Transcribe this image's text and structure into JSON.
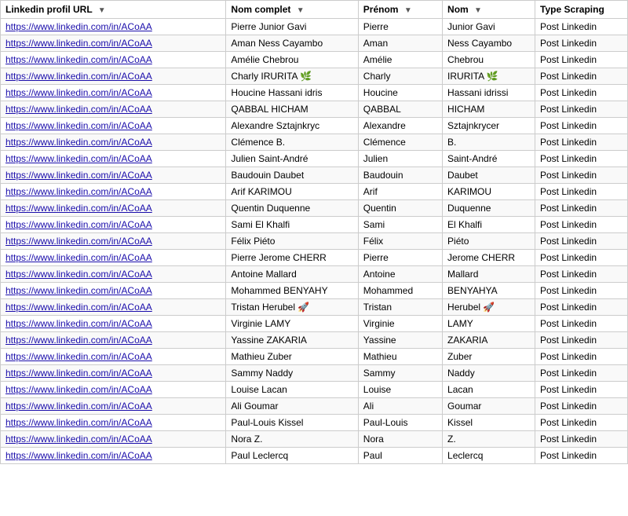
{
  "table": {
    "headers": [
      {
        "id": "linkedin-url",
        "label": "Linkedin profil URL"
      },
      {
        "id": "nom-complet",
        "label": "Nom complet"
      },
      {
        "id": "prenom",
        "label": "Prénom"
      },
      {
        "id": "nom",
        "label": "Nom"
      },
      {
        "id": "type-scraping",
        "label": "Type Scraping"
      }
    ],
    "rows": [
      {
        "url": "https://www.linkedin.com/in/ACoAA",
        "nom_complet": "Pierre Junior Gavi",
        "prenom": "Pierre",
        "nom": "Junior Gavi",
        "type": "Post Linkedin"
      },
      {
        "url": "https://www.linkedin.com/in/ACoAA",
        "nom_complet": "Aman Ness Cayambo",
        "prenom": "Aman",
        "nom": "Ness Cayambo",
        "type": "Post Linkedin"
      },
      {
        "url": "https://www.linkedin.com/in/ACoAA",
        "nom_complet": "Amélie Chebrou",
        "prenom": "Amélie",
        "nom": "Chebrou",
        "type": "Post Linkedin"
      },
      {
        "url": "https://www.linkedin.com/in/ACoAA",
        "nom_complet": "Charly IRURITA 🌿",
        "prenom": "Charly",
        "nom": "IRURITA 🌿",
        "type": "Post Linkedin"
      },
      {
        "url": "https://www.linkedin.com/in/ACoAA",
        "nom_complet": "Houcine Hassani idris",
        "prenom": "Houcine",
        "nom": "Hassani idrissi",
        "type": "Post Linkedin"
      },
      {
        "url": "https://www.linkedin.com/in/ACoAA",
        "nom_complet": "QABBAL HICHAM",
        "prenom": "QABBAL",
        "nom": "HICHAM",
        "type": "Post Linkedin"
      },
      {
        "url": "https://www.linkedin.com/in/ACoAA",
        "nom_complet": "Alexandre Sztajnkryc",
        "prenom": "Alexandre",
        "nom": "Sztajnkrycer",
        "type": "Post Linkedin"
      },
      {
        "url": "https://www.linkedin.com/in/ACoAA",
        "nom_complet": "Clémence B.",
        "prenom": "Clémence",
        "nom": "B.",
        "type": "Post Linkedin"
      },
      {
        "url": "https://www.linkedin.com/in/ACoAA",
        "nom_complet": "Julien Saint-André",
        "prenom": "Julien",
        "nom": "Saint-André",
        "type": "Post Linkedin"
      },
      {
        "url": "https://www.linkedin.com/in/ACoAA",
        "nom_complet": "Baudouin Daubet",
        "prenom": "Baudouin",
        "nom": "Daubet",
        "type": "Post Linkedin"
      },
      {
        "url": "https://www.linkedin.com/in/ACoAA",
        "nom_complet": "Arif KARIMOU",
        "prenom": "Arif",
        "nom": "KARIMOU",
        "type": "Post Linkedin"
      },
      {
        "url": "https://www.linkedin.com/in/ACoAA",
        "nom_complet": "Quentin Duquenne",
        "prenom": "Quentin",
        "nom": "Duquenne",
        "type": "Post Linkedin"
      },
      {
        "url": "https://www.linkedin.com/in/ACoAA",
        "nom_complet": "Sami El Khalfi",
        "prenom": "Sami",
        "nom": "El Khalfi",
        "type": "Post Linkedin"
      },
      {
        "url": "https://www.linkedin.com/in/ACoAA",
        "nom_complet": "Félix Piéto",
        "prenom": "Félix",
        "nom": "Piéto",
        "type": "Post Linkedin"
      },
      {
        "url": "https://www.linkedin.com/in/ACoAA",
        "nom_complet": "Pierre Jerome CHERR",
        "prenom": "Pierre",
        "nom": "Jerome CHERR",
        "type": "Post Linkedin"
      },
      {
        "url": "https://www.linkedin.com/in/ACoAA",
        "nom_complet": "Antoine Mallard",
        "prenom": "Antoine",
        "nom": "Mallard",
        "type": "Post Linkedin"
      },
      {
        "url": "https://www.linkedin.com/in/ACoAA",
        "nom_complet": "Mohammed BENYAHY",
        "prenom": "Mohammed",
        "nom": "BENYAHYA",
        "type": "Post Linkedin"
      },
      {
        "url": "https://www.linkedin.com/in/ACoAA",
        "nom_complet": "Tristan Herubel 🚀",
        "prenom": "Tristan",
        "nom": "Herubel 🚀",
        "type": "Post Linkedin"
      },
      {
        "url": "https://www.linkedin.com/in/ACoAA",
        "nom_complet": "Virginie LAMY",
        "prenom": "Virginie",
        "nom": "LAMY",
        "type": "Post Linkedin"
      },
      {
        "url": "https://www.linkedin.com/in/ACoAA",
        "nom_complet": "Yassine ZAKARIA",
        "prenom": "Yassine",
        "nom": "ZAKARIA",
        "type": "Post Linkedin"
      },
      {
        "url": "https://www.linkedin.com/in/ACoAA",
        "nom_complet": "Mathieu Zuber",
        "prenom": "Mathieu",
        "nom": "Zuber",
        "type": "Post Linkedin"
      },
      {
        "url": "https://www.linkedin.com/in/ACoAA",
        "nom_complet": "Sammy Naddy",
        "prenom": "Sammy",
        "nom": "Naddy",
        "type": "Post Linkedin"
      },
      {
        "url": "https://www.linkedin.com/in/ACoAA",
        "nom_complet": "Louise Lacan",
        "prenom": "Louise",
        "nom": "Lacan",
        "type": "Post Linkedin"
      },
      {
        "url": "https://www.linkedin.com/in/ACoAA",
        "nom_complet": "Ali Goumar",
        "prenom": "Ali",
        "nom": "Goumar",
        "type": "Post Linkedin"
      },
      {
        "url": "https://www.linkedin.com/in/ACoAA",
        "nom_complet": "Paul-Louis Kissel",
        "prenom": "Paul-Louis",
        "nom": "Kissel",
        "type": "Post Linkedin"
      },
      {
        "url": "https://www.linkedin.com/in/ACoAA",
        "nom_complet": "Nora Z.",
        "prenom": "Nora",
        "nom": "Z.",
        "type": "Post Linkedin"
      },
      {
        "url": "https://www.linkedin.com/in/ACoAA",
        "nom_complet": "Paul Leclercq",
        "prenom": "Paul",
        "nom": "Leclercq",
        "type": "Post Linkedin"
      }
    ]
  }
}
